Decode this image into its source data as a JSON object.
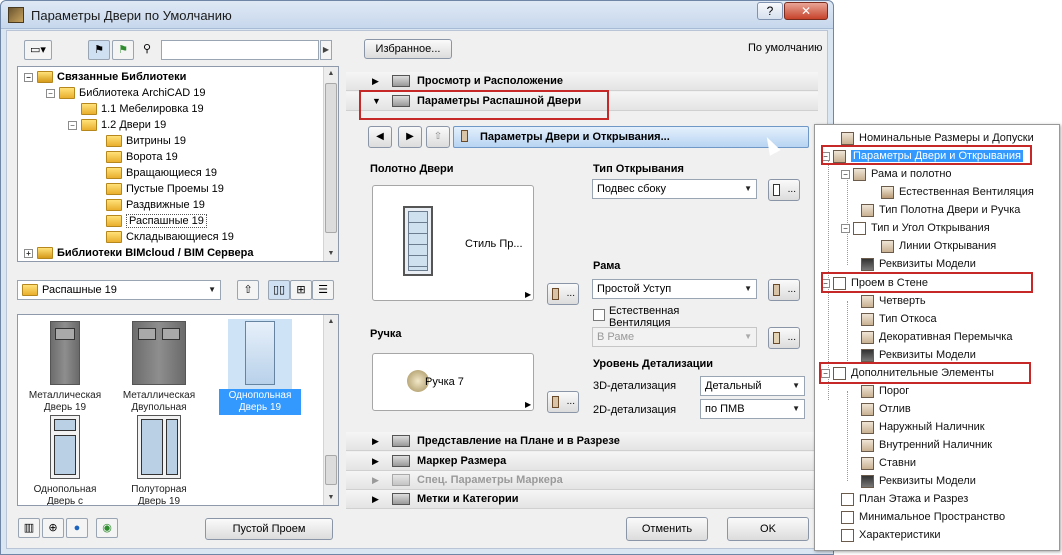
{
  "window": {
    "title": "Параметры Двери по Умолчанию",
    "help_label": "?",
    "close_label": "✕"
  },
  "library_tree": {
    "items": [
      {
        "label": "Связанные Библиотеки",
        "expander": "−"
      },
      {
        "label": "Библиотека ArchiCAD 19",
        "expander": "−"
      },
      {
        "label": "1.1 Мебелировка 19",
        "expander": ""
      },
      {
        "label": "1.2 Двери 19",
        "expander": "−"
      },
      {
        "label": "Витрины 19",
        "expander": ""
      },
      {
        "label": "Ворота 19",
        "expander": ""
      },
      {
        "label": "Вращающиеся 19",
        "expander": ""
      },
      {
        "label": "Пустые Проемы 19",
        "expander": ""
      },
      {
        "label": "Раздвижные 19",
        "expander": ""
      },
      {
        "label": "Распашные 19",
        "expander": ""
      },
      {
        "label": "Складывающиеся 19",
        "expander": ""
      },
      {
        "label": "Библиотеки BIMcloud / BIM Сервера",
        "expander": "+"
      }
    ]
  },
  "folder_combo": {
    "value": "Распашные 19"
  },
  "gallery": {
    "items": [
      {
        "label": "Металлическая Дверь 19"
      },
      {
        "label": "Металлическая Двупольная две..."
      },
      {
        "label": "Однопольная Дверь 19"
      },
      {
        "label": "Однопольная Дверь с Фрамуг..."
      },
      {
        "label": "Полуторная Дверь 19"
      }
    ]
  },
  "empty_opening_button": "Пустой Проем",
  "favorites_button": "Избранное...",
  "default_label": "По умолчанию",
  "sections": {
    "preview_placement": "Просмотр и Расположение",
    "swing_door_params": "Параметры Распашной Двери",
    "plan_section": "Представление на Плане и в Разрезе",
    "dimension_marker": "Маркер Размера",
    "custom_marker": "Спец. Параметры Маркера",
    "tags_categories": "Метки и Категории"
  },
  "page_selector": {
    "value": "Параметры Двери и Открывания..."
  },
  "door_panel": {
    "leaf_label": "Полотно Двери",
    "leaf_style": "Стиль Пр...",
    "handle_label": "Ручка",
    "handle_value": "Ручка 7",
    "more_label": "..."
  },
  "opening_type": {
    "label": "Тип Открывания",
    "value": "Подвес сбоку"
  },
  "frame": {
    "label": "Рама",
    "value": "Простой Уступ",
    "natural_vent_label": "Естественная Вентиляция",
    "natural_vent_value": "В Раме"
  },
  "detail_level": {
    "label": "Уровень Детализации",
    "detail_3d_label": "3D-детализация",
    "detail_3d_value": "Детальный",
    "detail_2d_label": "2D-детализация",
    "detail_2d_value": "по ПМВ"
  },
  "cancel_button": "Отменить",
  "ok_button": "OK",
  "help_tree": {
    "items": [
      "Номинальные Размеры и Допуски",
      "Параметры Двери и Открывания",
      "Рама и полотно",
      "Естественная Вентиляция",
      "Тип Полотна Двери и Ручка",
      "Тип и Угол Открывания",
      "Линии Открывания",
      "Реквизиты Модели",
      "Проем в Стене",
      "Четверть",
      "Тип Откоса",
      "Декоративная Перемычка",
      "Реквизиты Модели",
      "Дополнительные Элементы",
      "Порог",
      "Отлив",
      "Наружный Наличник",
      "Внутренний Наличник",
      "Ставни",
      "Реквизиты Модели",
      "План Этажа и Разрез",
      "Минимальное Пространство",
      "Характеристики"
    ],
    "expanders": {
      "minus": "−"
    }
  },
  "colors": {
    "accent": "#3399ff",
    "annotation_red": "#c62828",
    "dialog_bg": "#f0f0f0"
  }
}
